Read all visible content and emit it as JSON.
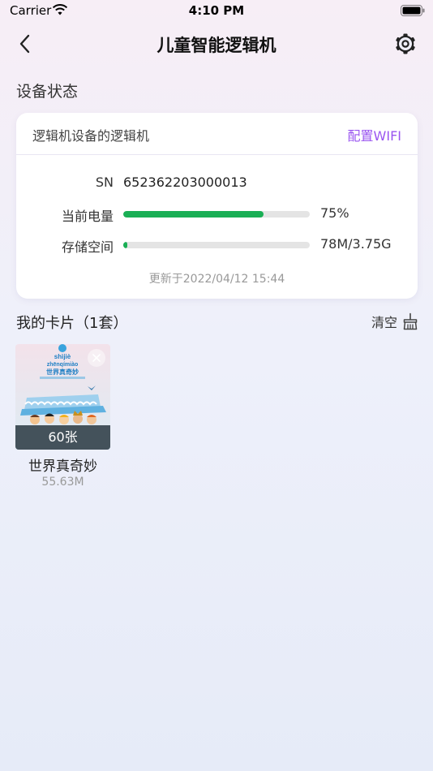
{
  "status_bar": {
    "carrier": "Carrier",
    "time": "4:10 PM"
  },
  "nav": {
    "title": "儿童智能逻辑机"
  },
  "device_section": {
    "title": "设备状态",
    "device_name": "逻辑机设备的逻辑机",
    "wifi_link": "配置WIFI",
    "sn_label": "SN",
    "sn_value": "652362203000013",
    "battery_label": "当前电量",
    "battery_percent": 75,
    "battery_text": "75%",
    "storage_label": "存储空间",
    "storage_fraction": 0.02,
    "storage_text": "78M/3.75G",
    "updated": "更新于2022/04/12 15:44"
  },
  "cards_section": {
    "title": "我的卡片（1套）",
    "clear_label": "清空",
    "items": [
      {
        "count": "60张",
        "name": "世界真奇妙",
        "size": "55.63M",
        "cover_pinyin_1": "shìjiè",
        "cover_pinyin_2": "zhēnqímiào",
        "cover_title": "世界真奇妙"
      }
    ]
  },
  "colors": {
    "accent": "#9a55f0",
    "battery": "#1aaf55",
    "track": "#e4e4e4"
  }
}
